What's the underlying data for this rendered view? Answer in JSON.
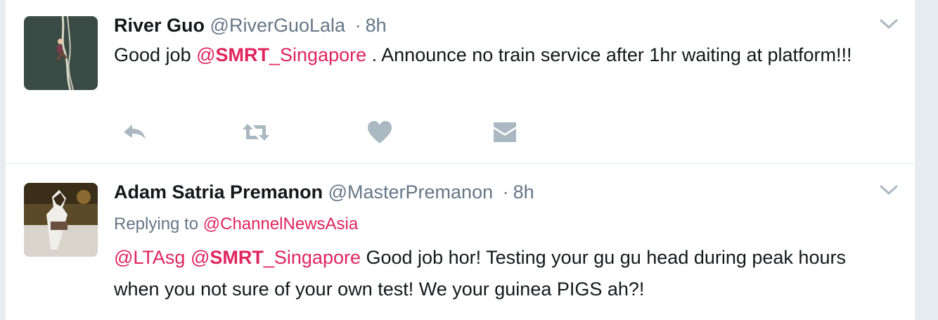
{
  "tweets": [
    {
      "fullname": "River Guo",
      "username": "@RiverGuoLala",
      "separator": "·",
      "time": "8h",
      "text": {
        "prefix": "Good job ",
        "mention_at": "@",
        "mention_bold": "SMRT",
        "mention_rest": "_Singapore",
        "suffix": " . Announce no train service after 1hr waiting at platform!!!"
      },
      "actions": [
        "reply-icon",
        "retweet-icon",
        "like-icon",
        "message-icon"
      ]
    },
    {
      "fullname": "Adam Satria Premanon",
      "username": "@MasterPremanon",
      "separator": "·",
      "time": "8h",
      "replying_label": "Replying to",
      "replying_to": "@ChannelNewsAsia",
      "text": {
        "mention1": "@LTAsg",
        "mention2_at": "@",
        "mention2_bold": "SMRT",
        "mention2_rest": "_Singapore",
        "body": " Good job hor! Testing your gu gu head during peak hours when you not sure of your own test! We your guinea PIGS ah?!"
      }
    }
  ],
  "colors": {
    "background": "#e6ecf0",
    "card": "#ffffff",
    "mention": "#e0245e",
    "secondary": "#657786",
    "icon": "#aab8c2"
  }
}
